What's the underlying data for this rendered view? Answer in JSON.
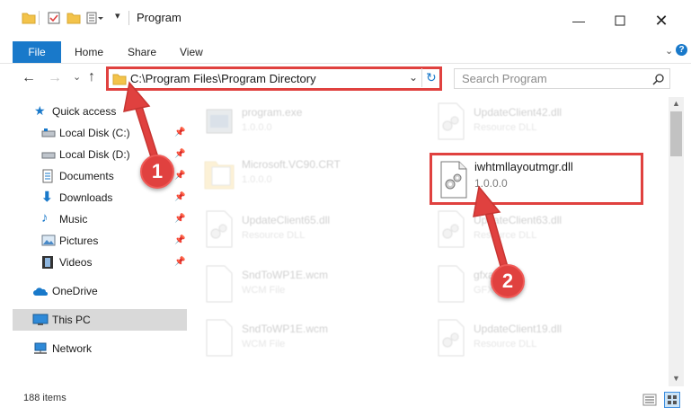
{
  "window": {
    "title": "Program",
    "controls": [
      "minimize-icon",
      "maximize-icon",
      "close-icon"
    ]
  },
  "ribbon": {
    "tabs": [
      "File",
      "Home",
      "Share",
      "View"
    ]
  },
  "address": {
    "path": "C:\\Program Files\\Program Directory",
    "search_placeholder": "Search Program"
  },
  "sidebar": {
    "items": [
      {
        "label": "Quick access",
        "icon": "star-icon"
      },
      {
        "label": "Local Disk (C:)",
        "icon": "drive-icon",
        "pinned": true
      },
      {
        "label": "Local Disk (D:)",
        "icon": "drive-icon",
        "pinned": true
      },
      {
        "label": "Documents",
        "icon": "documents-icon",
        "pinned": true
      },
      {
        "label": "Downloads",
        "icon": "download-icon",
        "pinned": true
      },
      {
        "label": "Music",
        "icon": "music-icon",
        "pinned": true
      },
      {
        "label": "Pictures",
        "icon": "pictures-icon",
        "pinned": true
      },
      {
        "label": "Videos",
        "icon": "video-icon",
        "pinned": true
      },
      {
        "label": "OneDrive",
        "icon": "cloud-icon"
      },
      {
        "label": "This PC",
        "icon": "computer-icon",
        "selected": true
      },
      {
        "label": "Network",
        "icon": "network-icon"
      }
    ]
  },
  "files": [
    {
      "name": "program.exe",
      "sub": "1.0.0.0",
      "highlight": false
    },
    {
      "name": "UpdateClient42.dll",
      "sub": "Resource DLL",
      "highlight": false
    },
    {
      "name": "Microsoft.VC90.CRT",
      "sub": "1.0.0.0",
      "highlight": false
    },
    {
      "name": "iwhtmllayoutmgr.dll",
      "sub": "1.0.0.0",
      "highlight": true
    },
    {
      "name": "UpdateClient65.dll",
      "sub": "Resource DLL",
      "highlight": false
    },
    {
      "name": "UpdateClient63.dll",
      "sub": "Resource DLL",
      "highlight": false
    },
    {
      "name": "SndToWP1E.wcm",
      "sub": "WCM File",
      "highlight": false
    },
    {
      "name": "gfxapi.dll",
      "sub": "GFX",
      "highlight": false
    },
    {
      "name": "SndToWP1E.wcm",
      "sub": "WCM File",
      "highlight": false
    },
    {
      "name": "UpdateClient19.dll",
      "sub": "Resource DLL",
      "highlight": false
    }
  ],
  "status": {
    "count": "188 items"
  },
  "callouts": [
    "1",
    "2"
  ],
  "colors": {
    "accent": "#1979ca",
    "highlight_red": "#e0413f",
    "selected_bg": "#d9d9d9"
  }
}
